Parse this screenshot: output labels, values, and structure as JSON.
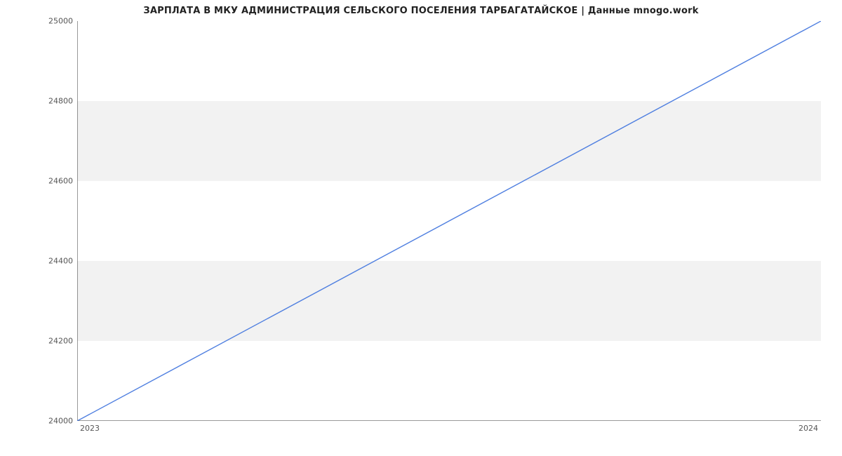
{
  "chart_data": {
    "type": "line",
    "title": "ЗАРПЛАТА В МКУ АДМИНИСТРАЦИЯ СЕЛЬСКОГО ПОСЕЛЕНИЯ ТАРБАГАТАЙСКОЕ | Данные mnogo.work",
    "xlabel": "",
    "ylabel": "",
    "x": [
      2023,
      2024
    ],
    "values": [
      24000,
      25000
    ],
    "xticks": [
      "2023",
      "2024"
    ],
    "yticks": [
      "24000",
      "24200",
      "24400",
      "24600",
      "24800",
      "25000"
    ],
    "xlim": [
      2023,
      2024
    ],
    "ylim": [
      24000,
      25000
    ],
    "line_color": "#4f7fe0",
    "grid_bands": true
  }
}
